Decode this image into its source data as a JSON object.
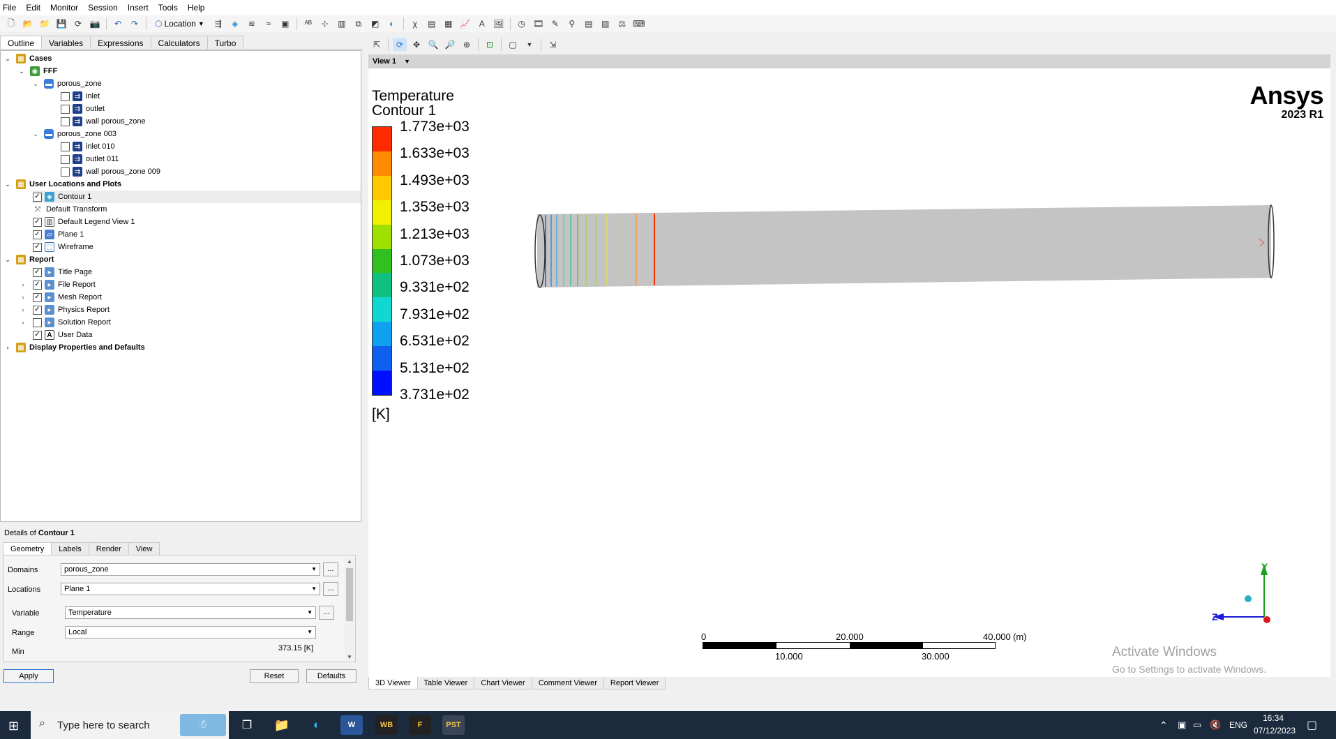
{
  "menu": [
    "File",
    "Edit",
    "Monitor",
    "Session",
    "Insert",
    "Tools",
    "Help"
  ],
  "toolbar": {
    "location_label": "Location"
  },
  "left_tabs": [
    "Outline",
    "Variables",
    "Expressions",
    "Calculators",
    "Turbo"
  ],
  "tree": {
    "cases": "Cases",
    "fff": "FFF",
    "porous_zone": "porous_zone",
    "inlet": "inlet",
    "outlet": "outlet",
    "wall_porous_zone": "wall porous_zone",
    "porous_zone_003": "porous_zone 003",
    "inlet_010": "inlet 010",
    "outlet_011": "outlet 011",
    "wall_porous_zone_009": "wall porous_zone 009",
    "user_locations": "User Locations and Plots",
    "contour_1": "Contour 1",
    "default_transform": "Default Transform",
    "default_legend": "Default Legend View 1",
    "plane_1": "Plane 1",
    "wireframe": "Wireframe",
    "report": "Report",
    "title_page": "Title Page",
    "file_report": "File Report",
    "mesh_report": "Mesh Report",
    "physics_report": "Physics Report",
    "solution_report": "Solution Report",
    "user_data": "User Data",
    "display_props": "Display Properties and Defaults"
  },
  "details": {
    "title_prefix": "Details of ",
    "title_object": "Contour 1",
    "tabs": [
      "Geometry",
      "Labels",
      "Render",
      "View"
    ],
    "domains_label": "Domains",
    "domains_value": "porous_zone",
    "locations_label": "Locations",
    "locations_value": "Plane 1",
    "variable_label": "Variable",
    "variable_value": "Temperature",
    "range_label": "Range",
    "range_value": "Local",
    "min_label": "Min",
    "min_value": "373.15 [K]",
    "dots": "...",
    "apply": "Apply",
    "reset": "Reset",
    "defaults": "Defaults"
  },
  "viewer": {
    "view_name": "View 1",
    "legend_title_1": "Temperature",
    "legend_title_2": "Contour 1",
    "legend_unit": "[K]",
    "legend_labels": [
      "1.773e+03",
      "1.633e+03",
      "1.493e+03",
      "1.353e+03",
      "1.213e+03",
      "1.073e+03",
      "9.331e+02",
      "7.931e+02",
      "6.531e+02",
      "5.131e+02",
      "3.731e+02"
    ],
    "legend_colors": [
      "#ff2b00",
      "#ff8c00",
      "#ffc800",
      "#f0f000",
      "#a0e000",
      "#30c020",
      "#10c080",
      "#10d8d0",
      "#10a0f0",
      "#1060f0",
      "#0010ff"
    ],
    "brand_name": "Ansys",
    "brand_version": "2023 R1",
    "scale_top": [
      "0",
      "20.000",
      "40.000",
      "(m)"
    ],
    "scale_bottom": [
      "10.000",
      "30.000"
    ],
    "axis_y": "Y",
    "axis_z": "Z",
    "watermark_1": "Activate Windows",
    "watermark_2": "Go to Settings to activate Windows.",
    "tabs": [
      "3D Viewer",
      "Table Viewer",
      "Chart Viewer",
      "Comment Viewer",
      "Report Viewer"
    ]
  },
  "taskbar": {
    "search_placeholder": "Type here to search",
    "apps": [
      "WB",
      "F",
      "PST"
    ],
    "lang": "ENG",
    "time": "16:34",
    "date": "07/12/2023"
  },
  "colors": {
    "mesh_grey": "#c4c4c4",
    "taskbar": "#1c2a3d",
    "axis_y": "#1aa01a",
    "axis_z": "#1a1ad8",
    "axis_x": "#d81a1a"
  }
}
